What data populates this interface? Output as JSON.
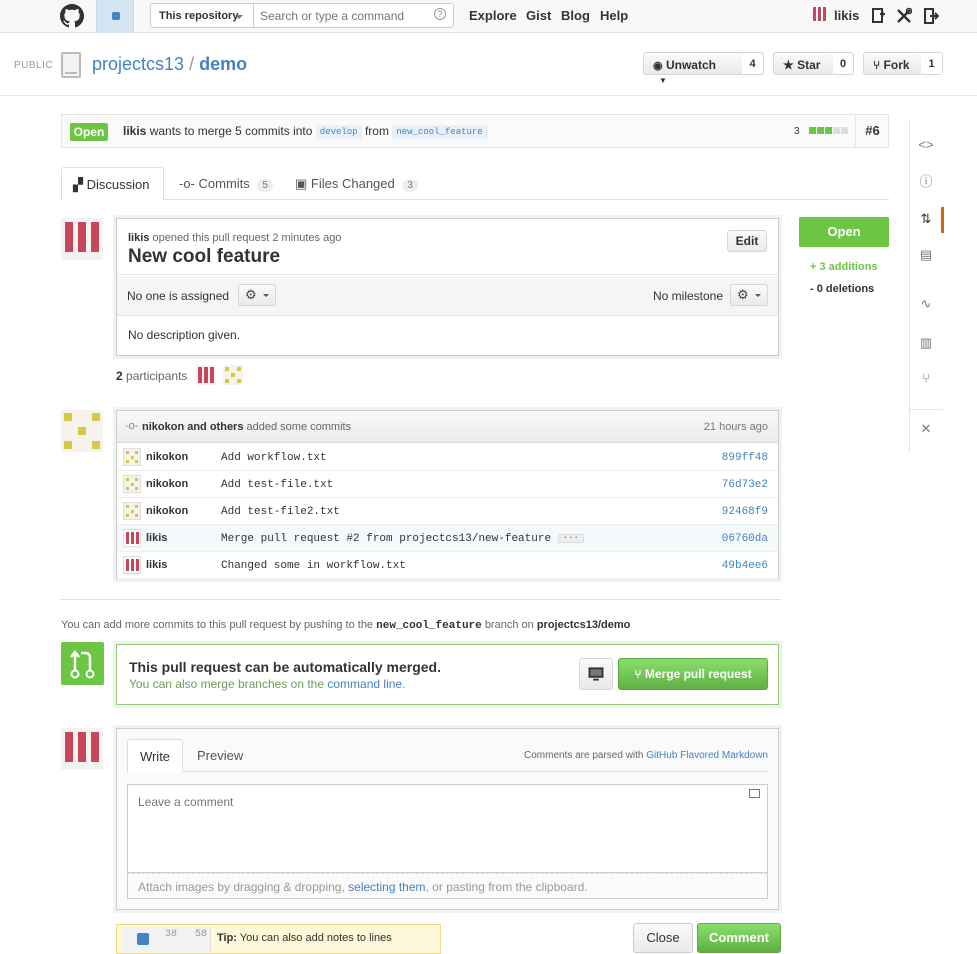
{
  "header": {
    "search_scope": "This repository",
    "search_placeholder": "Search or type a command",
    "search_help": "?",
    "nav": [
      "Explore",
      "Gist",
      "Blog",
      "Help"
    ],
    "username": "likis"
  },
  "repo": {
    "visibility": "PUBLIC",
    "owner": "projectcs13",
    "separator": "/",
    "name": "demo",
    "unwatch_label": "Unwatch",
    "watch_count": "4",
    "star_label": "Star",
    "star_count": "0",
    "fork_label": "Fork",
    "fork_count": "1"
  },
  "pull_request": {
    "state": "Open",
    "author": "likis",
    "merge_text": "wants to merge 5 commits into",
    "base_branch": "develop",
    "from_text": "from",
    "head_branch": "new_cool_feature",
    "diff_count": "3",
    "number": "#6",
    "opened_text": "opened this pull request 2 minutes ago",
    "title": "New cool feature",
    "edit_label": "Edit",
    "assignee_text": "No one is assigned",
    "milestone_text": "No milestone",
    "description": "No description given.",
    "additions": "+ 3 additions",
    "deletions": "- 0 deletions",
    "participants_count": "2",
    "participants_label": "participants"
  },
  "tabs": [
    {
      "label": "Discussion",
      "count": ""
    },
    {
      "label": "Commits",
      "count": "5"
    },
    {
      "label": "Files Changed",
      "count": "3"
    }
  ],
  "commits": {
    "header_authors": "nikokon and others",
    "header_action": "added some commits",
    "header_time": "21 hours ago",
    "rows": [
      {
        "author": "nikokon",
        "message": "Add workflow.txt",
        "sha": "899ff48",
        "avatar": "nikokon"
      },
      {
        "author": "nikokon",
        "message": "Add test-file.txt",
        "sha": "76d73e2",
        "avatar": "nikokon"
      },
      {
        "author": "nikokon",
        "message": "Add test-file2.txt",
        "sha": "92468f9",
        "avatar": "nikokon"
      },
      {
        "author": "likis",
        "message": "Merge pull request #2 from projectcs13/new-feature",
        "sha": "06760da",
        "avatar": "likis",
        "ellipsis": "···"
      },
      {
        "author": "likis",
        "message": "Changed some in workflow.txt",
        "sha": "49b4ee6",
        "avatar": "likis"
      }
    ]
  },
  "push_note": {
    "prefix": "You can add more commits to this pull request by pushing to the",
    "branch": "new_cool_feature",
    "middle": "branch on",
    "repo": "projectcs13/demo"
  },
  "merge": {
    "title": "This pull request can be automatically merged.",
    "sub_prefix": "You can also merge branches on the",
    "sub_link": "command line",
    "sub_suffix": ".",
    "button": "Merge pull request"
  },
  "comment": {
    "write_tab": "Write",
    "preview_tab": "Preview",
    "parsed_prefix": "Comments are parsed with",
    "parsed_link": "GitHub Flavored Markdown",
    "placeholder": "Leave a comment",
    "attach_prefix": "Attach images by dragging & dropping,",
    "attach_link": "selecting them",
    "attach_suffix": ", or pasting from the clipboard.",
    "tip_label": "Tip:",
    "tip_text": "You can also add notes to lines",
    "tip_line_a": "38",
    "tip_line_b": "58",
    "close_label": "Close",
    "comment_label": "Comment"
  },
  "colors": {
    "open_green": "#6cc644",
    "link_blue": "#4183c4",
    "likis_avatar": "#c8465a",
    "nikokon_avatar": "#d6c94a",
    "active_nav": "#d26911"
  },
  "icons": {
    "sidenav": [
      "code-icon",
      "issues-icon",
      "pull-requests-icon",
      "wiki-icon",
      "pulse-icon",
      "graphs-icon",
      "network-icon",
      "settings-icon"
    ]
  }
}
